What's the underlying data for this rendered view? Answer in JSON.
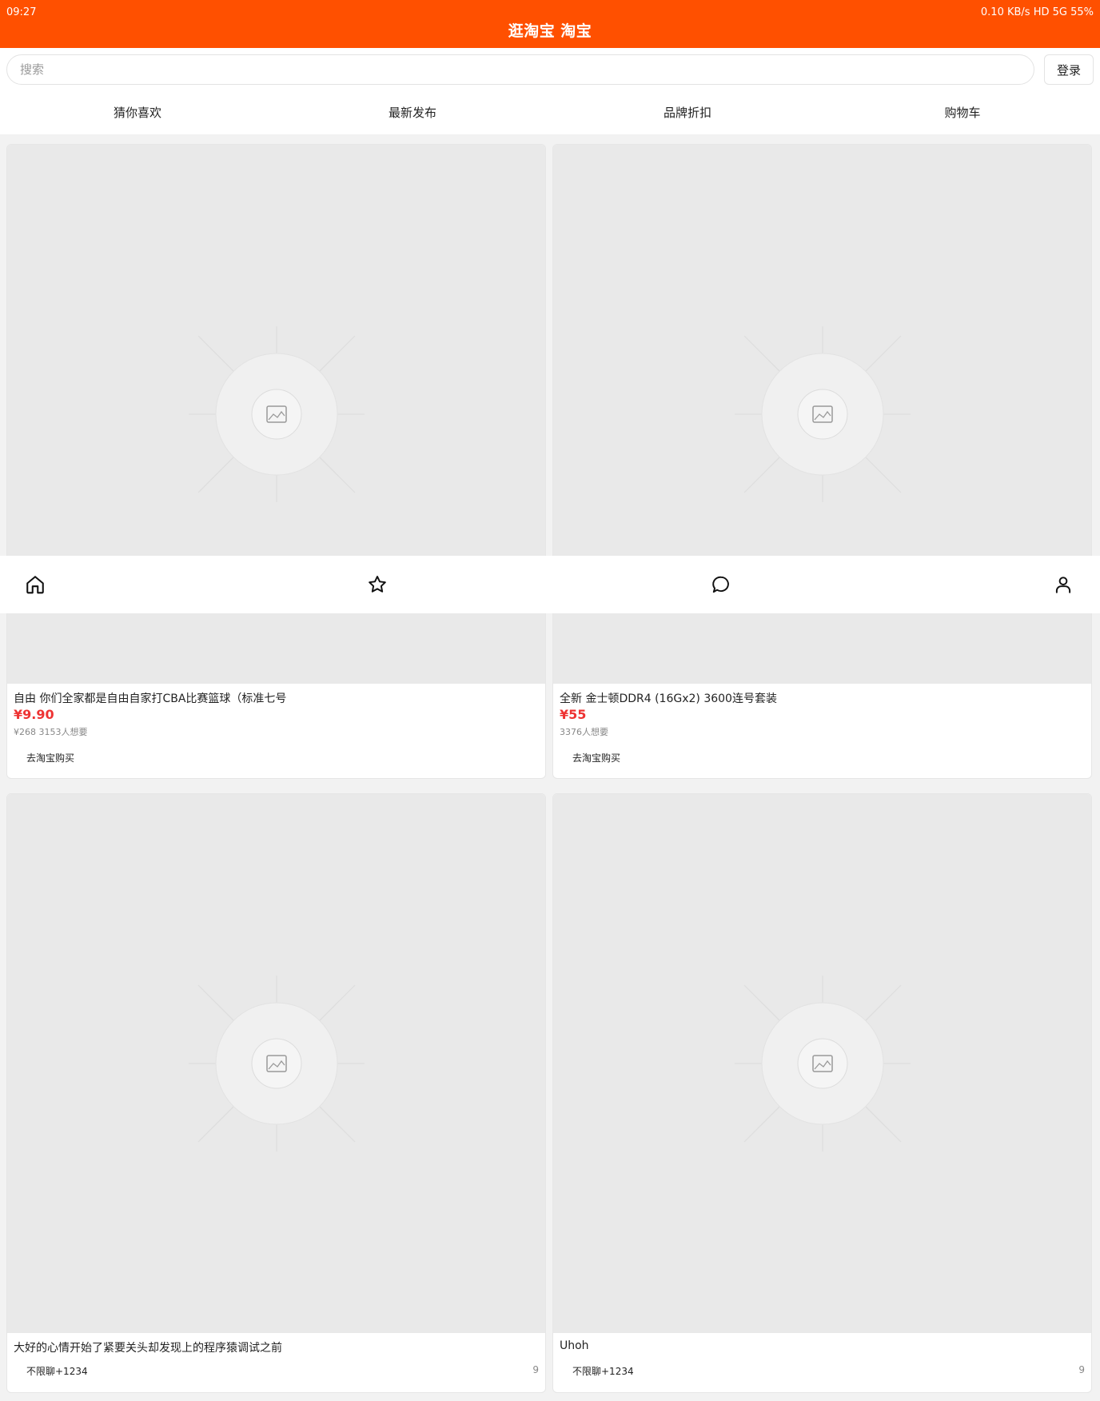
{
  "status": {
    "time": "09:27",
    "system": "0.10 KB/s HD 5G 55%"
  },
  "app": {
    "title": "逛淘宝 淘宝"
  },
  "search": {
    "placeholder": "搜索",
    "login_label": "登录"
  },
  "tabs": [
    {
      "label": "猜你喜欢"
    },
    {
      "label": "最新发布"
    },
    {
      "label": "品牌折扣"
    },
    {
      "label": "购物车"
    }
  ],
  "products": [
    {
      "title": "自由 你们全家都是自由自家打CBA比赛篮球（标准七号",
      "price": "¥9.90",
      "meta": "¥268 3153人想要",
      "buy_label": "去淘宝购买"
    },
    {
      "title": "全新 金士顿DDR4 (16Gx2) 3600连号套装",
      "price": "¥55",
      "meta": "3376人想要",
      "buy_label": "去淘宝购买"
    },
    {
      "title": "大好的心情开始了紧要关头却发现上的程序猿调试之前",
      "chat_label": "不限聊+1234",
      "count": "9"
    },
    {
      "title": "Uhoh",
      "chat_label": "不限聊+1234",
      "count": "9"
    }
  ],
  "bottom_nav": [
    {
      "icon": "home-icon"
    },
    {
      "icon": "star-icon"
    },
    {
      "icon": "chat-bubble-icon"
    },
    {
      "icon": "person-icon"
    }
  ],
  "colors": {
    "brand": "#ff5000",
    "price": "#ee3333"
  }
}
